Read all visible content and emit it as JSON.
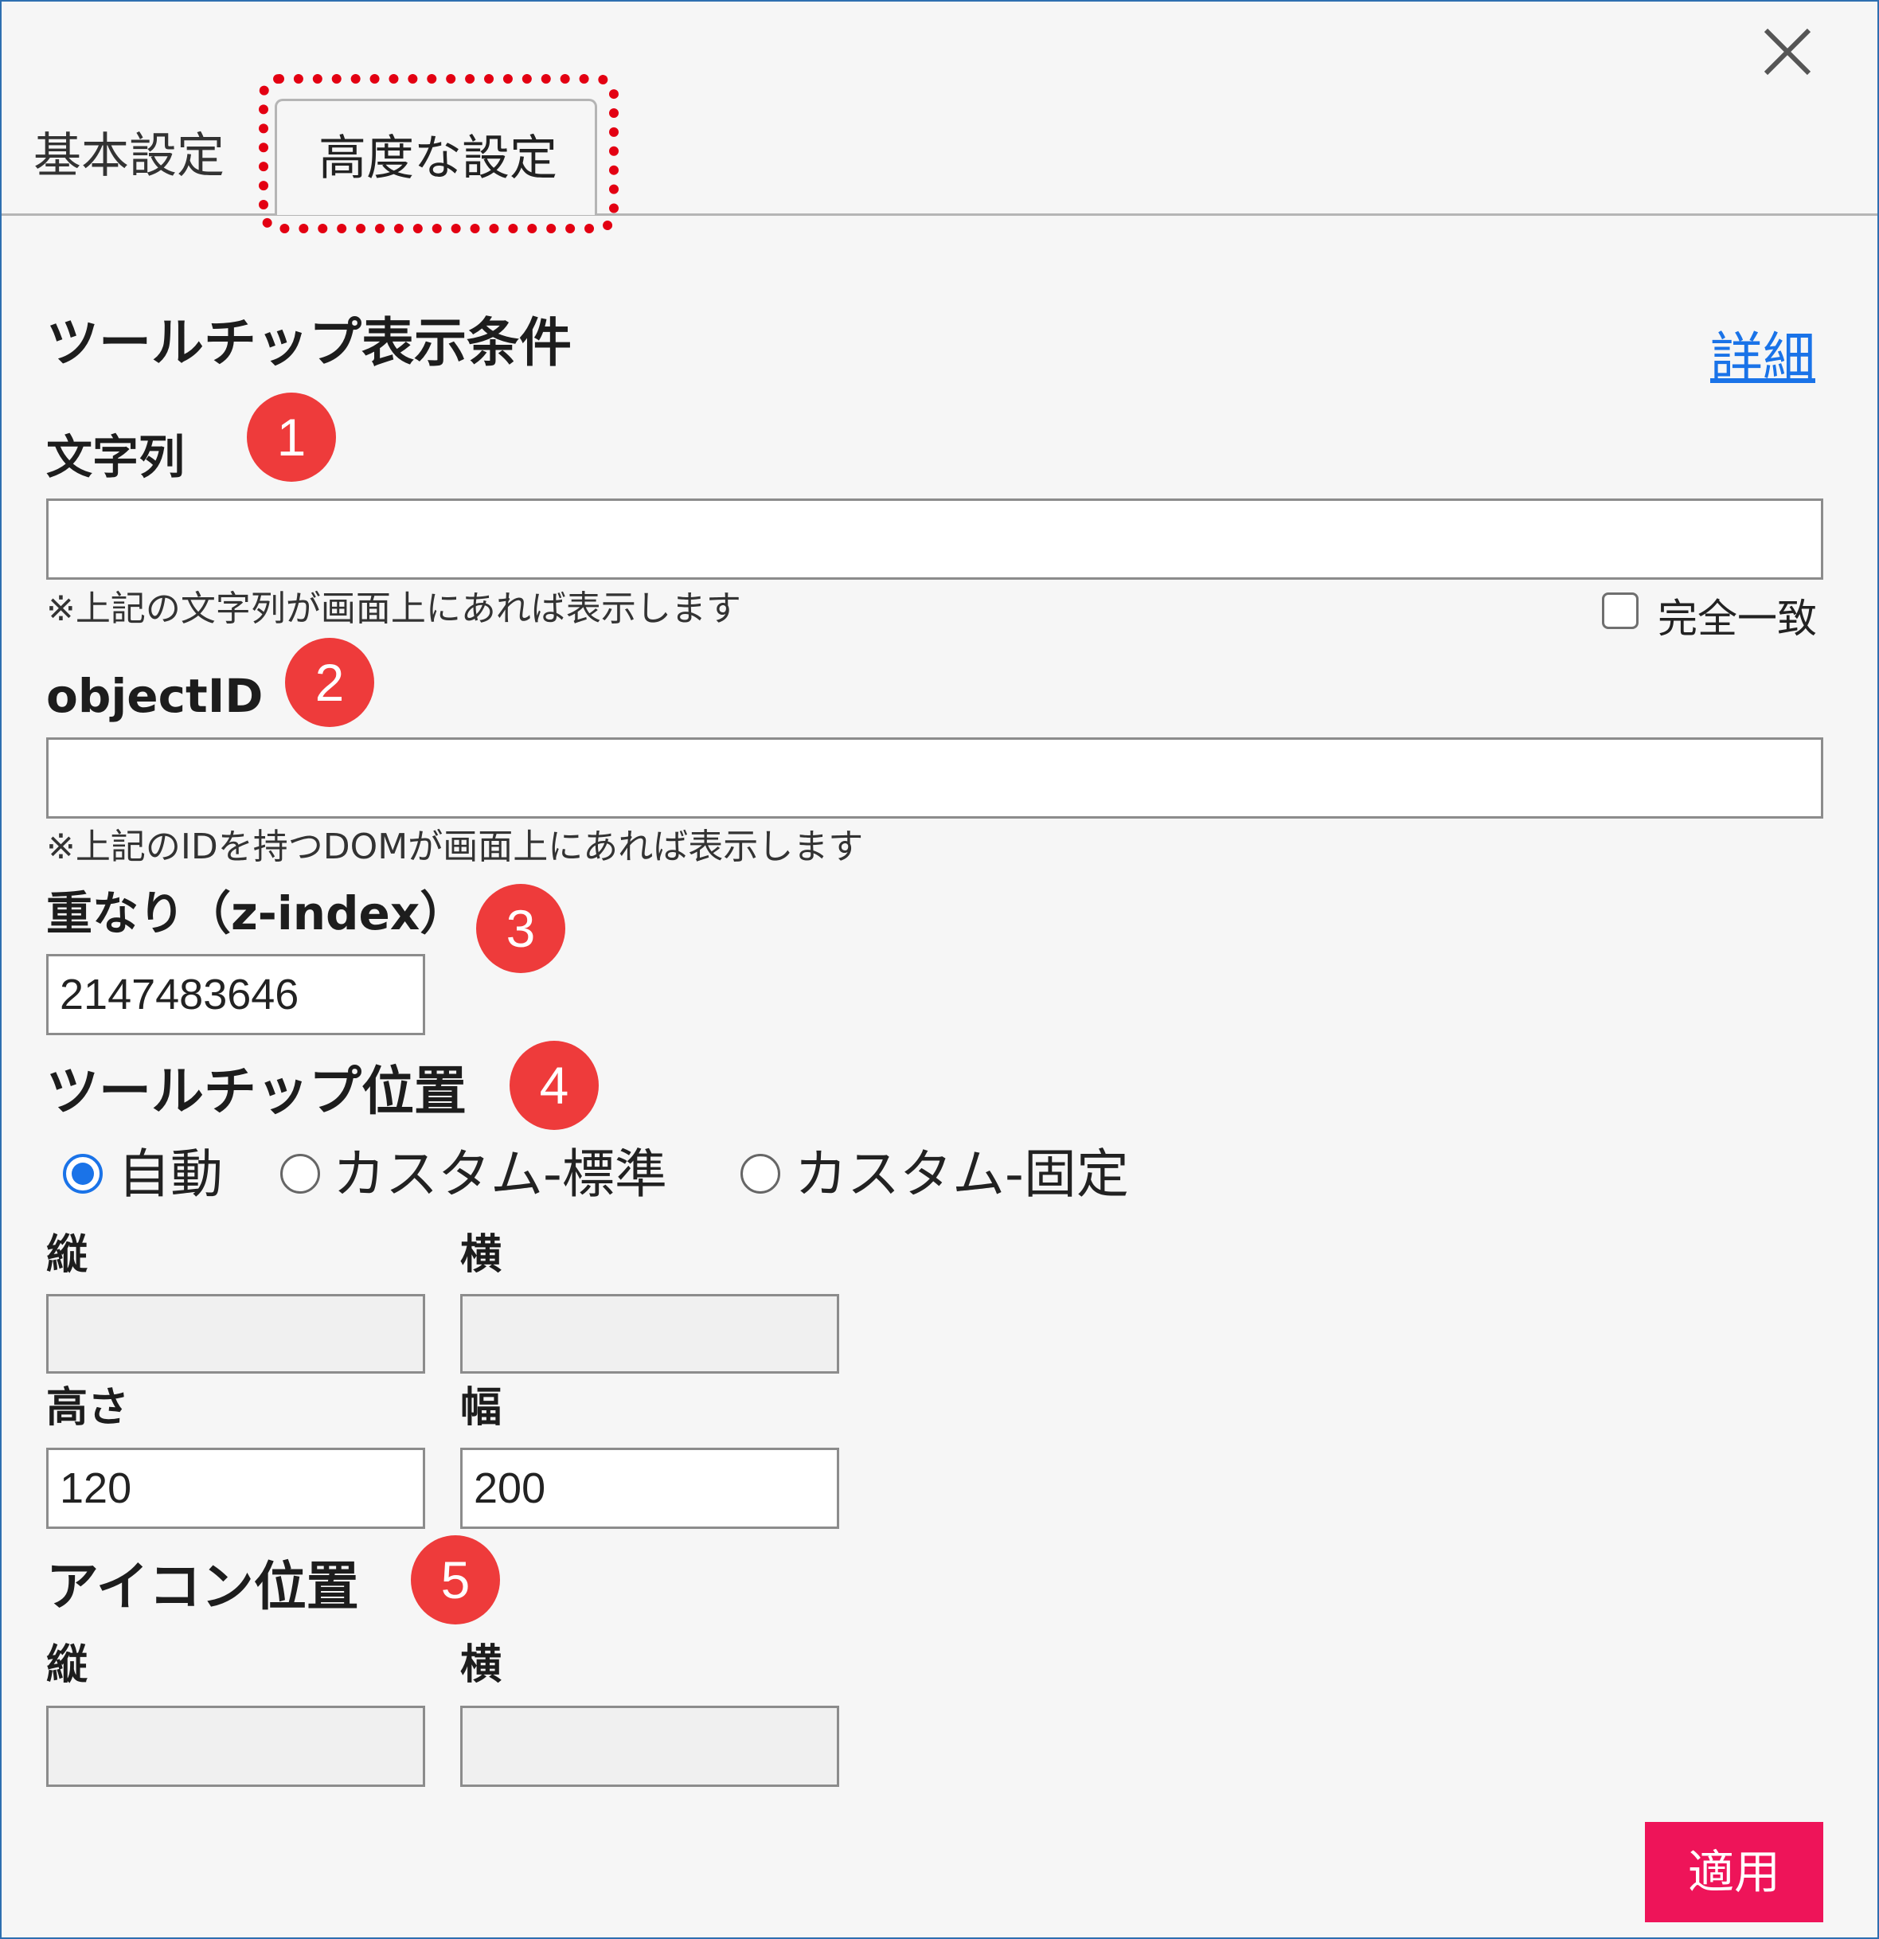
{
  "tabs": {
    "basic": "基本設定",
    "advanced": "高度な設定"
  },
  "section_title": "ツールチップ表示条件",
  "detail_link": "詳細",
  "badges": [
    "1",
    "2",
    "3",
    "4",
    "5"
  ],
  "text_condition": {
    "label": "文字列",
    "value": "",
    "note": "※上記の文字列が画面上にあれば表示します",
    "exact_match_label": "完全一致",
    "exact_match_checked": false
  },
  "object_id": {
    "label": "objectID",
    "value": "",
    "note": "※上記のIDを持つDOMが画面上にあれば表示します"
  },
  "z_index": {
    "label": "重なり（z-index）",
    "value": "2147483646"
  },
  "tooltip_position": {
    "label": "ツールチップ位置",
    "options": [
      "自動",
      "カスタム-標準",
      "カスタム-固定"
    ],
    "selected": "自動",
    "vertical_label": "縦",
    "horizontal_label": "横",
    "vertical_value": "",
    "horizontal_value": "",
    "height_label": "高さ",
    "width_label": "幅",
    "height_value": "120",
    "width_value": "200"
  },
  "icon_position": {
    "label": "アイコン位置",
    "vertical_label": "縦",
    "horizontal_label": "横",
    "vertical_value": "",
    "horizontal_value": ""
  },
  "apply_button": "適用",
  "colors": {
    "accent": "#ee1459",
    "badge": "#ee3b3b",
    "link": "#1a73e8",
    "highlight": "#e30012"
  }
}
